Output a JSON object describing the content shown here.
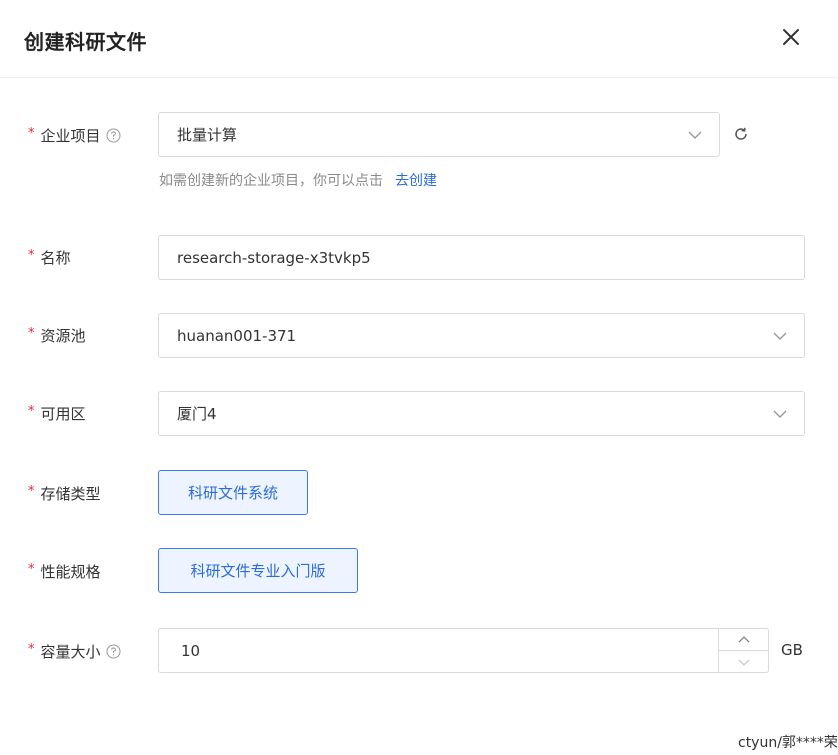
{
  "dialog": {
    "title": "创建科研文件",
    "close_icon": "close-icon"
  },
  "form": {
    "project": {
      "label": "企业项目",
      "value": "批量计算",
      "hint": "如需创建新的企业项目，你可以点击",
      "hint_link": "去创建"
    },
    "name": {
      "label": "名称",
      "value": "research-storage-x3tvkp5"
    },
    "pool": {
      "label": "资源池",
      "value": "huanan001-371"
    },
    "zone": {
      "label": "可用区",
      "value": "厦门4"
    },
    "storage_type": {
      "label": "存储类型",
      "option": "科研文件系统"
    },
    "spec": {
      "label": "性能规格",
      "option": "科研文件专业入门版"
    },
    "capacity": {
      "label": "容量大小",
      "value": "10",
      "unit": "GB"
    }
  },
  "watermark": "ctyun/郭****荣",
  "colors": {
    "required": "#f5222d",
    "link": "#2b6bdb",
    "chip_border": "#3a7ce6",
    "chip_bg": "#eef4ff"
  }
}
